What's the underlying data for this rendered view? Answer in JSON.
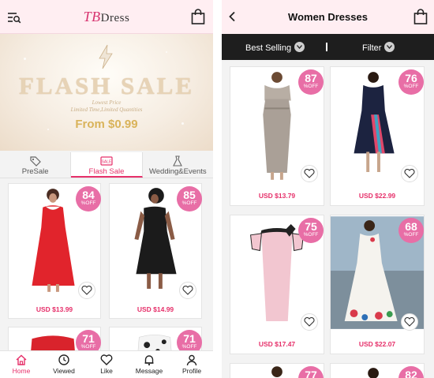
{
  "left": {
    "header": {
      "brand_prefix": "TB",
      "brand_rest": "Dress"
    },
    "banner": {
      "title": "FLASH SALE",
      "subtitle_line1": "Lowest Price",
      "subtitle_line2": "Limited Time,Limited Quantities",
      "price": "From $0.99"
    },
    "tabs": [
      {
        "label": "PreSale",
        "icon": "tag-icon"
      },
      {
        "label": "Flash Sale",
        "icon": "sale-box-icon",
        "active": true
      },
      {
        "label": "Wedding&Events",
        "icon": "wedding-dress-icon"
      }
    ],
    "products": [
      {
        "discount": "84",
        "off": "%OFF",
        "price": "USD $13.99"
      },
      {
        "discount": "85",
        "off": "%OFF",
        "price": "USD $14.99"
      },
      {
        "discount": "71",
        "off": "%OFF"
      },
      {
        "discount": "71",
        "off": "%OFF"
      }
    ],
    "nav": [
      {
        "label": "Home",
        "icon": "home-icon",
        "active": true
      },
      {
        "label": "Viewed",
        "icon": "history-icon"
      },
      {
        "label": "Like",
        "icon": "heart-icon"
      },
      {
        "label": "Message",
        "icon": "bell-icon"
      },
      {
        "label": "Profile",
        "icon": "user-icon"
      }
    ]
  },
  "right": {
    "header": {
      "title": "Women Dresses"
    },
    "sortbar": {
      "sort_label": "Best Selling",
      "filter_label": "Filter"
    },
    "products": [
      {
        "discount": "87",
        "off": "%OFF",
        "price": "USD $13.79"
      },
      {
        "discount": "76",
        "off": "%OFF",
        "price": "USD $22.99"
      },
      {
        "discount": "75",
        "off": "%OFF",
        "price": "USD $17.47"
      },
      {
        "discount": "68",
        "off": "%OFF",
        "price": "USD $22.07"
      },
      {
        "discount": "77"
      },
      {
        "discount": "82"
      }
    ]
  },
  "colors": {
    "accent": "#e6306a",
    "badge": "#e86ea6",
    "header_bg": "#ffeef2",
    "sortbar_bg": "#1e1e1e"
  }
}
